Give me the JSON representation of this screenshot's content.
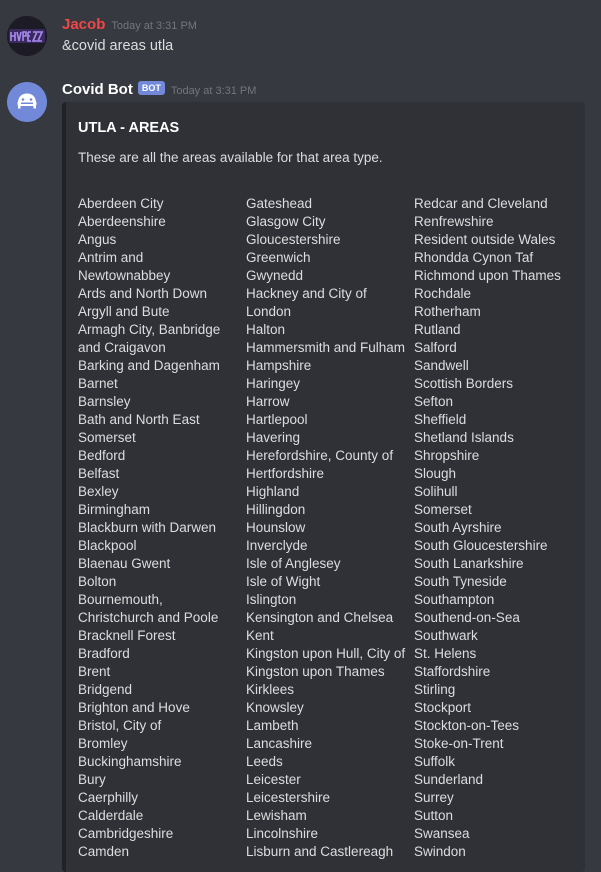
{
  "messages": [
    {
      "author": "Jacob",
      "author_color": "#f04747",
      "timestamp": "Today at 3:31 PM",
      "text": "&covid areas utla",
      "avatar_text": "HVPEZZ"
    },
    {
      "author": "Covid Bot",
      "author_color": "#ffffff",
      "badge": "BOT",
      "timestamp": "Today at 3:31 PM"
    }
  ],
  "embed": {
    "title": "UTLA - AREAS",
    "description": "These are all the areas available for that area type.",
    "columns": [
      [
        "Aberdeen City",
        "Aberdeenshire",
        "Angus",
        "Antrim and",
        "Newtownabbey",
        "Ards and North Down",
        "Argyll and Bute",
        "Armagh City, Banbridge",
        "and Craigavon",
        "Barking and Dagenham",
        "Barnet",
        "Barnsley",
        "Bath and North East",
        "Somerset",
        "Bedford",
        "Belfast",
        "Bexley",
        "Birmingham",
        "Blackburn with Darwen",
        "Blackpool",
        "Blaenau Gwent",
        "Bolton",
        "Bournemouth,",
        "Christchurch and Poole",
        "Bracknell Forest",
        "Bradford",
        "Brent",
        "Bridgend",
        "Brighton and Hove",
        "Bristol, City of",
        "Bromley",
        "Buckinghamshire",
        "Bury",
        "Caerphilly",
        "Calderdale",
        "Cambridgeshire",
        "Camden"
      ],
      [
        "Gateshead",
        "Glasgow City",
        "Gloucestershire",
        "Greenwich",
        "Gwynedd",
        "Hackney and City of",
        "London",
        "Halton",
        "Hammersmith and Fulham",
        "Hampshire",
        "Haringey",
        "Harrow",
        "Hartlepool",
        "Havering",
        "Herefordshire, County of",
        "Hertfordshire",
        "Highland",
        "Hillingdon",
        "Hounslow",
        "Inverclyde",
        "Isle of Anglesey",
        "Isle of Wight",
        "Islington",
        "Kensington and Chelsea",
        "Kent",
        "Kingston upon Hull, City of",
        "Kingston upon Thames",
        "Kirklees",
        "Knowsley",
        "Lambeth",
        "Lancashire",
        "Leeds",
        "Leicester",
        "Leicestershire",
        "Lewisham",
        "Lincolnshire",
        "Lisburn and Castlereagh"
      ],
      [
        "Redcar and Cleveland",
        "Renfrewshire",
        "Resident outside Wales",
        "Rhondda Cynon Taf",
        "Richmond upon Thames",
        "Rochdale",
        "Rotherham",
        "Rutland",
        "Salford",
        "Sandwell",
        "Scottish Borders",
        "Sefton",
        "Sheffield",
        "Shetland Islands",
        "Shropshire",
        "Slough",
        "Solihull",
        "Somerset",
        "South Ayrshire",
        "South Gloucestershire",
        "South Lanarkshire",
        "South Tyneside",
        "Southampton",
        "Southend-on-Sea",
        "Southwark",
        "St. Helens",
        "Staffordshire",
        "Stirling",
        "Stockport",
        "Stockton-on-Tees",
        "Stoke-on-Trent",
        "Suffolk",
        "Sunderland",
        "Surrey",
        "Sutton",
        "Swansea",
        "Swindon"
      ]
    ]
  }
}
